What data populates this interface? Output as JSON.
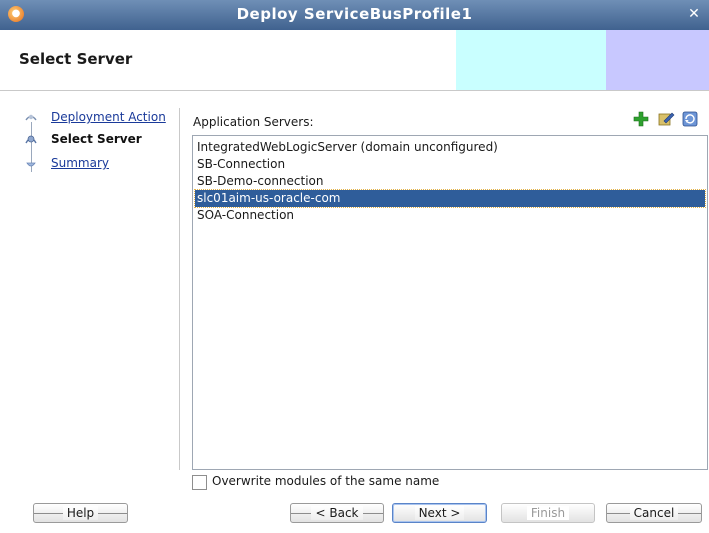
{
  "window": {
    "title": "Deploy ServiceBusProfile1",
    "app_icon": "jdeveloper-icon",
    "close_icon": "close-icon"
  },
  "header": {
    "title": "Select Server",
    "accent_colors": [
      "#c9ffff",
      "#c8c8ff"
    ]
  },
  "nav": {
    "items": [
      {
        "label": "Deployment Action",
        "state": "visited"
      },
      {
        "label": "Select Server",
        "state": "current"
      },
      {
        "label": "Summary",
        "state": "pending"
      }
    ]
  },
  "main": {
    "servers_label": "Application Servers:",
    "toolbar": {
      "add_icon": "add-icon",
      "edit_icon": "edit-icon",
      "refresh_icon": "refresh-icon"
    },
    "servers": [
      "IntegratedWebLogicServer (domain unconfigured)",
      "SB-Connection",
      "SB-Demo-connection",
      "slc01aim-us-oracle-com",
      "SOA-Connection"
    ],
    "selected_index": 3,
    "overwrite_label": "Overwrite modules of the same name",
    "overwrite_checked": false
  },
  "buttons": {
    "help": "Help",
    "back": "< Back",
    "next": "Next >",
    "finish": "Finish",
    "cancel": "Cancel"
  },
  "colors": {
    "selection": "#2f5d9a",
    "titlebar": "#4f72a0",
    "link": "#1a3a9a"
  }
}
